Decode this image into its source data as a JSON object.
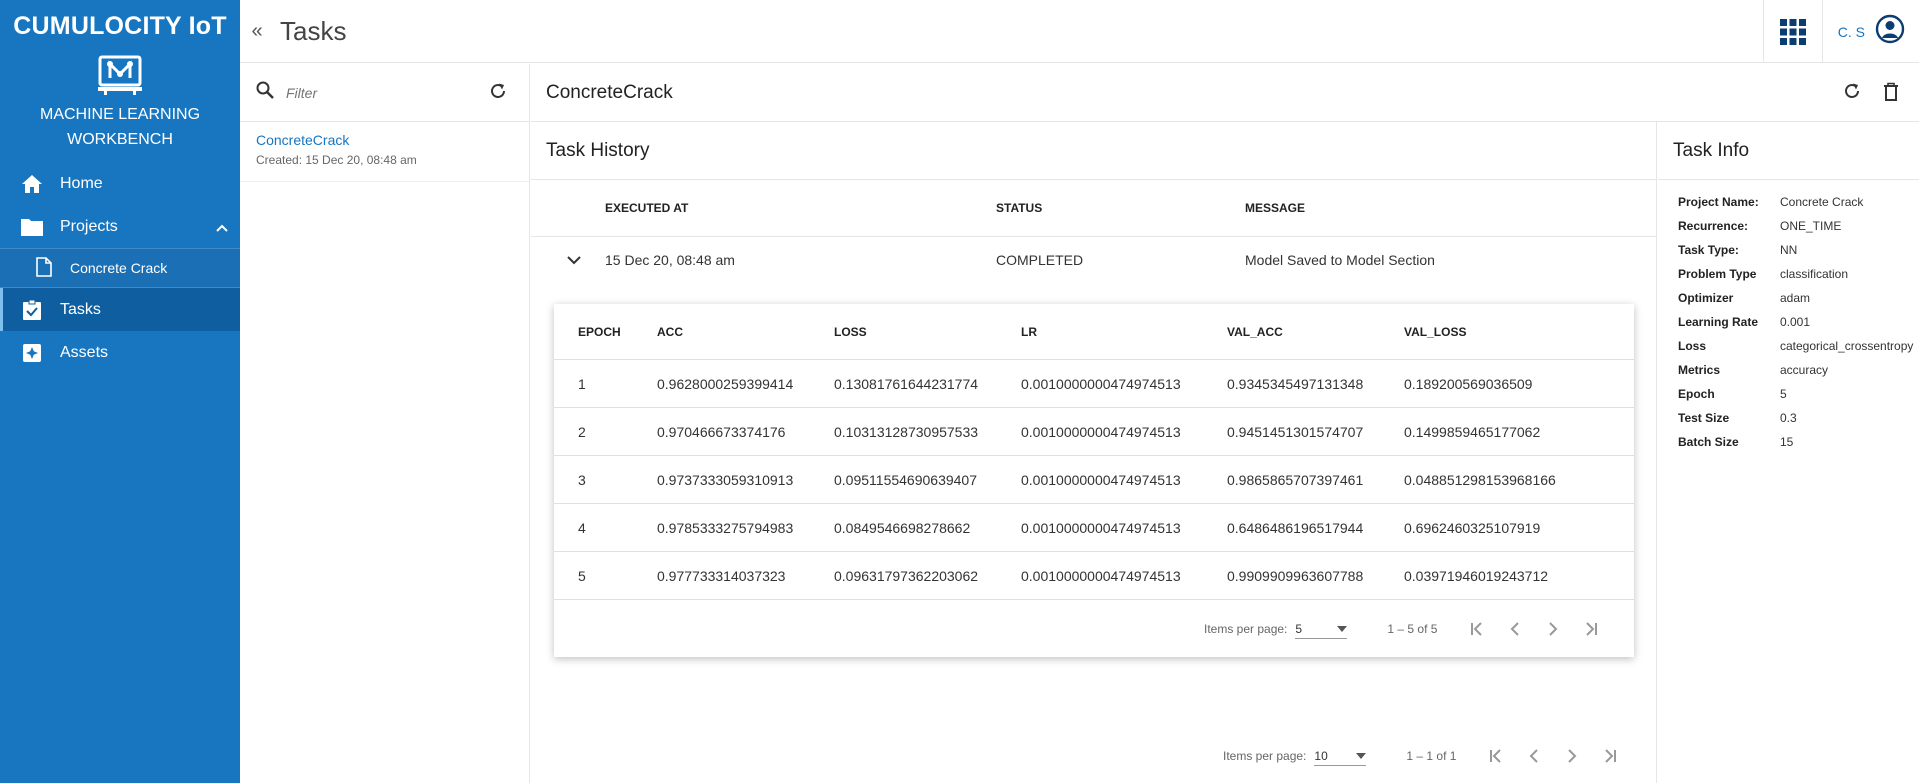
{
  "brand": "CUMULOCITY IoT",
  "app_name_line1": "MACHINE LEARNING",
  "app_name_line2": "WORKBENCH",
  "nav": {
    "home": "Home",
    "projects": "Projects",
    "project_child": "Concrete Crack",
    "tasks": "Tasks",
    "assets": "Assets"
  },
  "header": {
    "title": "Tasks",
    "user": "C. S"
  },
  "filter": {
    "placeholder": "Filter"
  },
  "task_list": [
    {
      "name": "ConcreteCrack",
      "created": "Created: 15 Dec 20, 08:48 am"
    }
  ],
  "main": {
    "title": "ConcreteCrack"
  },
  "history": {
    "title": "Task History",
    "columns": {
      "executed_at": "EXECUTED AT",
      "status": "STATUS",
      "message": "MESSAGE"
    },
    "rows": [
      {
        "executed_at": "15 Dec 20, 08:48 am",
        "status": "COMPLETED",
        "message": "Model Saved to Model Section"
      }
    ],
    "epochs": {
      "columns": [
        "EPOCH",
        "ACC",
        "LOSS",
        "LR",
        "VAL_ACC",
        "VAL_LOSS"
      ],
      "rows": [
        [
          "1",
          "0.9628000259399414",
          "0.13081761644231774",
          "0.0010000000474974513",
          "0.9345345497131348",
          "0.189200569036509"
        ],
        [
          "2",
          "0.970466673374176",
          "0.10313128730957533",
          "0.0010000000474974513",
          "0.9451451301574707",
          "0.1499859465177062"
        ],
        [
          "3",
          "0.9737333059310913",
          "0.09511554690639407",
          "0.0010000000474974513",
          "0.9865865707397461",
          "0.048851298153968166"
        ],
        [
          "4",
          "0.9785333275794983",
          "0.0849546698278662",
          "0.0010000000474974513",
          "0.6486486196517944",
          "0.6962460325107919"
        ],
        [
          "5",
          "0.977733314037323",
          "0.09631797362203062",
          "0.0010000000474974513",
          "0.9909909963607788",
          "0.03971946019243712"
        ]
      ],
      "pager": {
        "label": "Items per page:",
        "size": "5",
        "range": "1 – 5 of 5"
      }
    },
    "pager": {
      "label": "Items per page:",
      "size": "10",
      "range": "1 – 1 of 1"
    }
  },
  "info": {
    "title": "Task Info",
    "rows": [
      {
        "k": "Project Name:",
        "v": "Concrete Crack"
      },
      {
        "k": "Recurrence:",
        "v": "ONE_TIME"
      },
      {
        "k": "Task Type:",
        "v": "NN"
      },
      {
        "k": "Problem Type",
        "v": "classification"
      },
      {
        "k": "Optimizer",
        "v": "adam"
      },
      {
        "k": "Learning Rate",
        "v": "0.001"
      },
      {
        "k": "Loss",
        "v": "categorical_crossentropy"
      },
      {
        "k": "Metrics",
        "v": "accuracy"
      },
      {
        "k": "Epoch",
        "v": "5"
      },
      {
        "k": "Test Size",
        "v": "0.3"
      },
      {
        "k": "Batch Size",
        "v": "15"
      }
    ]
  },
  "colors": {
    "sidebar": "#1776bf",
    "active": "#0f5fa0",
    "link": "#1776bf"
  }
}
